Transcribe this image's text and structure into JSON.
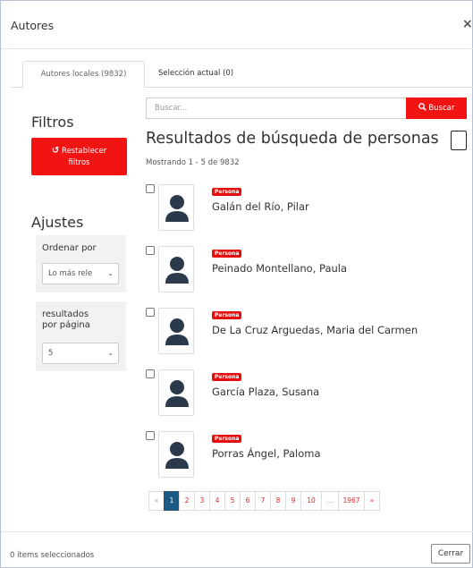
{
  "modal": {
    "title": "Autores",
    "close_glyph": "×"
  },
  "tabs": [
    {
      "label": "Autores locales (9832)",
      "active": true
    },
    {
      "label": "Selección actual (0)",
      "active": false
    }
  ],
  "filters": {
    "title": "Filtros",
    "reset_icon": "↺",
    "reset_line1": "Restablecer",
    "reset_line2": "filtros"
  },
  "settings": {
    "title": "Ajustes",
    "order_label": "Ordenar por",
    "order_value": "Lo más rele",
    "perpage_label_1": "resultados",
    "perpage_label_2": "por página",
    "perpage_value": "5"
  },
  "search": {
    "placeholder": "Buscar...",
    "button_label": "Buscar",
    "button_icon": "magnifier-icon"
  },
  "results": {
    "title": "Resultados de búsqueda de personas",
    "count_text": "Mostrando 1 - 5 de 9832",
    "items": [
      {
        "badge": "Persona",
        "name": "Galán del Río, Pilar"
      },
      {
        "badge": "Persona",
        "name": "Peinado Montellano, Paula"
      },
      {
        "badge": "Persona",
        "name": "De La Cruz Arguedas, Maria del Carmen"
      },
      {
        "badge": "Persona",
        "name": "García Plaza, Susana"
      },
      {
        "badge": "Persona",
        "name": "Porras Ángel, Paloma"
      }
    ]
  },
  "pagination": {
    "prev": "«",
    "pages": [
      "1",
      "2",
      "3",
      "4",
      "5",
      "6",
      "7",
      "8",
      "9",
      "10",
      "...",
      "1967"
    ],
    "active": "1",
    "next": "»"
  },
  "footer": {
    "selected_text": "0 ítems seleccionados",
    "close_label": "Cerrar"
  },
  "colors": {
    "accent": "#f21313",
    "active_page": "#1c5a86",
    "avatar": "#2b3a4b"
  }
}
